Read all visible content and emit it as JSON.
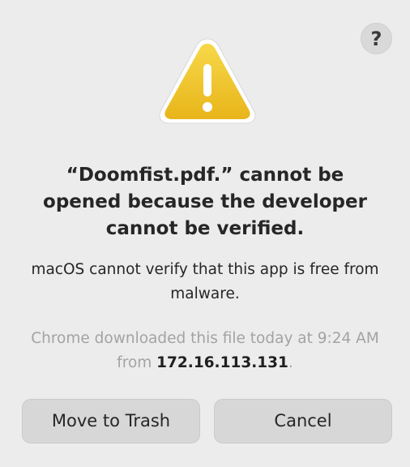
{
  "dialog": {
    "help_label": "?",
    "title": "“Doomfist.pdf.” cannot be opened because the developer cannot be verified.",
    "message": "macOS cannot verify that this app is free from malware.",
    "download_info_prefix": "Chrome downloaded this file today at 9:24 AM from ",
    "download_info_ip": "172.16.113.131",
    "download_info_suffix": ".",
    "icon": "warning-triangle-icon",
    "accent_color": "#f2c230"
  },
  "buttons": {
    "move_to_trash": "Move to Trash",
    "cancel": "Cancel"
  }
}
